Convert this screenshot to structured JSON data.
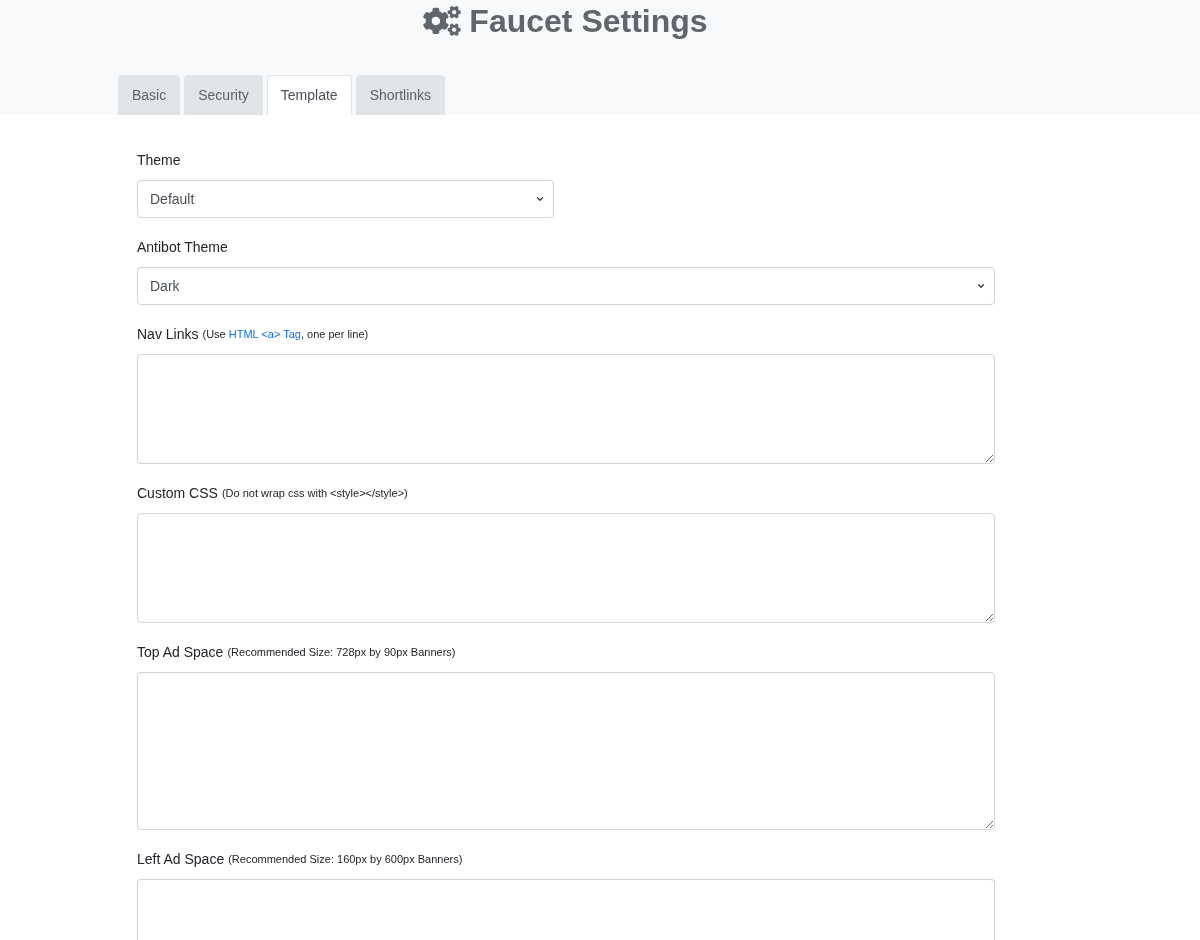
{
  "header": {
    "title": "Faucet Settings"
  },
  "tabs": [
    {
      "label": "Basic",
      "selected": false
    },
    {
      "label": "Security",
      "selected": false
    },
    {
      "label": "Template",
      "selected": true
    },
    {
      "label": "Shortlinks",
      "selected": false
    }
  ],
  "fields": [
    {
      "kind": "select",
      "label": "Theme",
      "value": "Default"
    },
    {
      "kind": "select",
      "label": "Antibot Theme",
      "value": "Dark"
    },
    {
      "kind": "textarea",
      "label": "Nav Links",
      "hint": {
        "text": "(Use ",
        "link": "HTML <a> Tag",
        "text_after": ", one per line)"
      }
    },
    {
      "kind": "textarea",
      "label": "Custom CSS",
      "hint": {
        "text": "(Do not wrap css with <style></style>)"
      }
    },
    {
      "kind": "textarea",
      "label": "Top Ad Space",
      "hint": {
        "text": "(Recommended Size: 728px by 90px Banners)"
      }
    },
    {
      "kind": "textarea",
      "label": "Left Ad Space",
      "hint": {
        "text": "(Recommended Size: 160px by 600px Banners)"
      }
    }
  ]
}
